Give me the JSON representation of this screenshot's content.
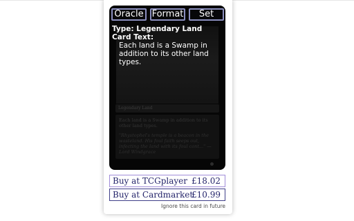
{
  "tabs": [
    {
      "label": "Oracle"
    },
    {
      "label": "Format"
    },
    {
      "label": "Set"
    }
  ],
  "oracle": {
    "type_line": "Type: Legendary Land",
    "card_text_heading": "Card Text:",
    "card_text_body": "Each land is a Swamp in addition to its other land types."
  },
  "card_image": {
    "type_line": "Legendary Land",
    "rules_text": "Each land is a Swamp in addition to its other land types.",
    "flavor_text": "\"Rhystophel's temple is a beacon in the wasteland. His foul faith seeps out, infecting the land with its foul cont...\" — Lord Windgrace"
  },
  "buy": [
    {
      "label": "Buy at TCGplayer",
      "price": "£18.02"
    },
    {
      "label": "Buy at Cardmarket",
      "price": "£10.99"
    }
  ],
  "ignore_label": "Ignore this card in future",
  "colors": {
    "tab_border": "#8b8fbf",
    "tcg_border": "#a08cd8",
    "cardmarket_border": "#3e3e88",
    "buy_text": "#24246a"
  }
}
